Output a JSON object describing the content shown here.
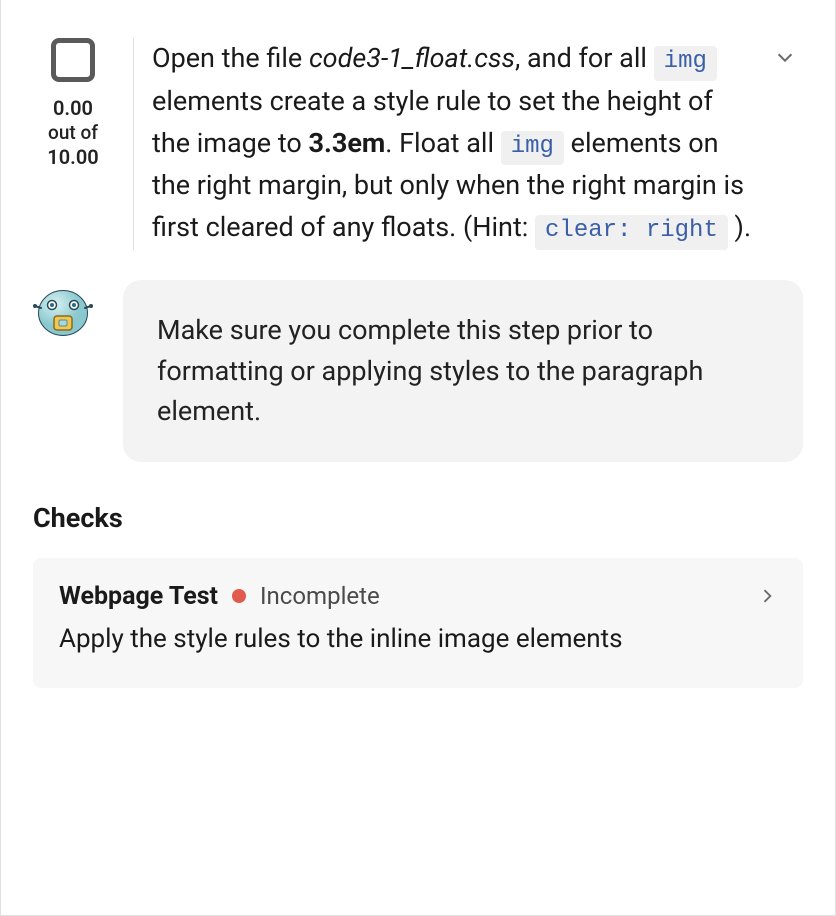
{
  "score": {
    "earned": "0.00",
    "out_of_label": "out of",
    "total": "10.00"
  },
  "instruction": {
    "open_text": "Open the file ",
    "filename": "code3-1_float.css",
    "after_file": ", and for all ",
    "img1": "img",
    "after_img1": " elements create a style rule to set the height of the image to ",
    "size": "3.3em",
    "after_size": ". Float all ",
    "img2": "img",
    "after_img2": " elements on the right margin, but only when the right margin is first cleared of any floats. (Hint: ",
    "hint_code": "clear: right",
    "after_hint": " )."
  },
  "hint": {
    "text": "Make sure you complete this step prior to formatting or applying styles to the paragraph element."
  },
  "checks": {
    "heading": "Checks",
    "items": [
      {
        "title": "Webpage Test",
        "status": "Incomplete",
        "status_color": "#e05a4d",
        "description": "Apply the style rules to the inline image elements"
      }
    ]
  }
}
